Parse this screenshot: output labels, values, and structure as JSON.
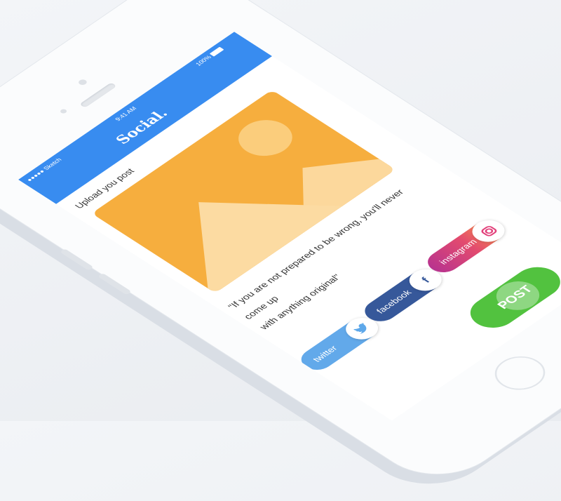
{
  "status_bar": {
    "carrier": "●●●●● Sketch",
    "time": "9:41 AM",
    "battery": "100%"
  },
  "header": {
    "title": "Social."
  },
  "main": {
    "upload_label": "Upload you post",
    "quote_line1": "\"If you are not prepared to be wrong, you'll never come up",
    "quote_line2": "with anything original\""
  },
  "share_buttons": [
    {
      "label": "twitter",
      "icon": "twitter-bird-icon",
      "color": "#62a9ea"
    },
    {
      "label": "facebook",
      "icon": "f",
      "color": "#36589a"
    },
    {
      "label": "instagram",
      "icon": "instagram-icon",
      "color": "#e34b6e"
    }
  ],
  "post_button": {
    "label": "POST",
    "color": "#52c23f"
  },
  "colors": {
    "header": "#388cf0",
    "image_placeholder": "#f6ae3e"
  }
}
